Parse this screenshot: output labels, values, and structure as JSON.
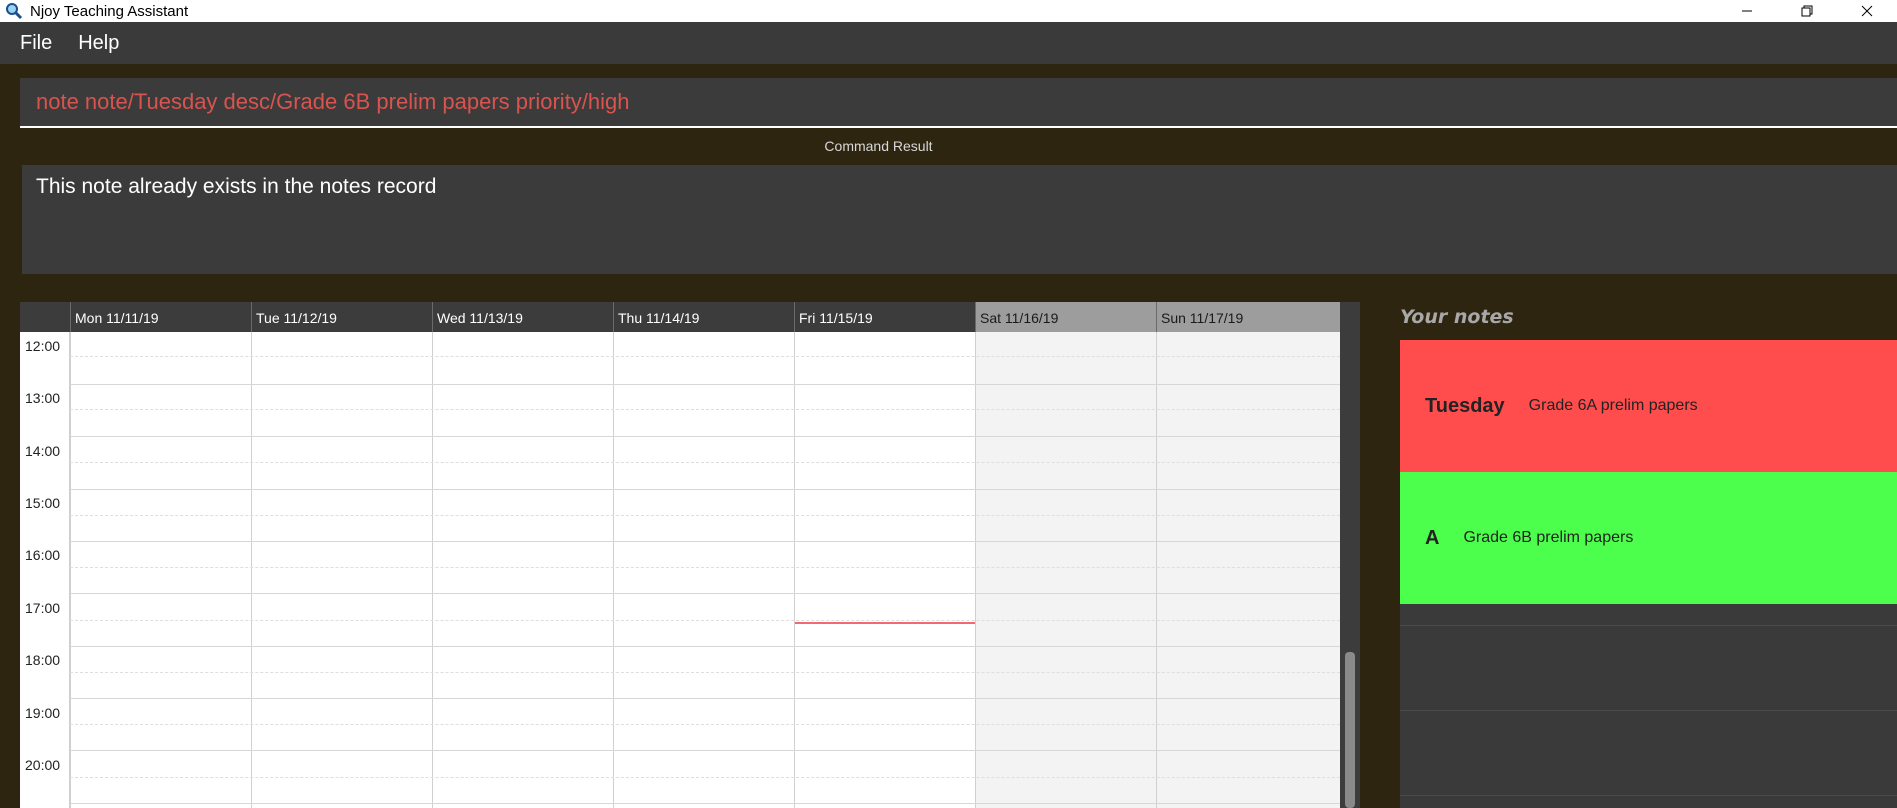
{
  "window": {
    "title": "Njoy Teaching Assistant",
    "minimize": "—",
    "restore": "❐",
    "close": "✕"
  },
  "menu": {
    "file": "File",
    "help": "Help"
  },
  "command": {
    "value": "note note/Tuesday desc/Grade 6B prelim papers priority/high",
    "color": "#d9534f"
  },
  "result": {
    "label": "Command Result",
    "text": "This note already exists in the notes record"
  },
  "calendar": {
    "days": [
      {
        "label": "Mon 11/11/19",
        "weekend": false
      },
      {
        "label": "Tue 11/12/19",
        "weekend": false
      },
      {
        "label": "Wed 11/13/19",
        "weekend": false
      },
      {
        "label": "Thu 11/14/19",
        "weekend": false
      },
      {
        "label": "Fri 11/15/19",
        "weekend": false
      },
      {
        "label": "Sat 11/16/19",
        "weekend": true
      },
      {
        "label": "Sun 11/17/19",
        "weekend": true
      }
    ],
    "hours": [
      "12:00",
      "13:00",
      "14:00",
      "15:00",
      "16:00",
      "17:00",
      "18:00",
      "19:00",
      "20:00"
    ],
    "current_time_marker_color": "#f06a74"
  },
  "notes": {
    "title": "Your notes",
    "items": [
      {
        "title": "Tuesday",
        "description": "Grade 6A prelim papers",
        "color": "#ff4d4d"
      },
      {
        "title": "A",
        "description": "Grade 6B prelim papers",
        "color": "#4cff4c"
      }
    ]
  }
}
